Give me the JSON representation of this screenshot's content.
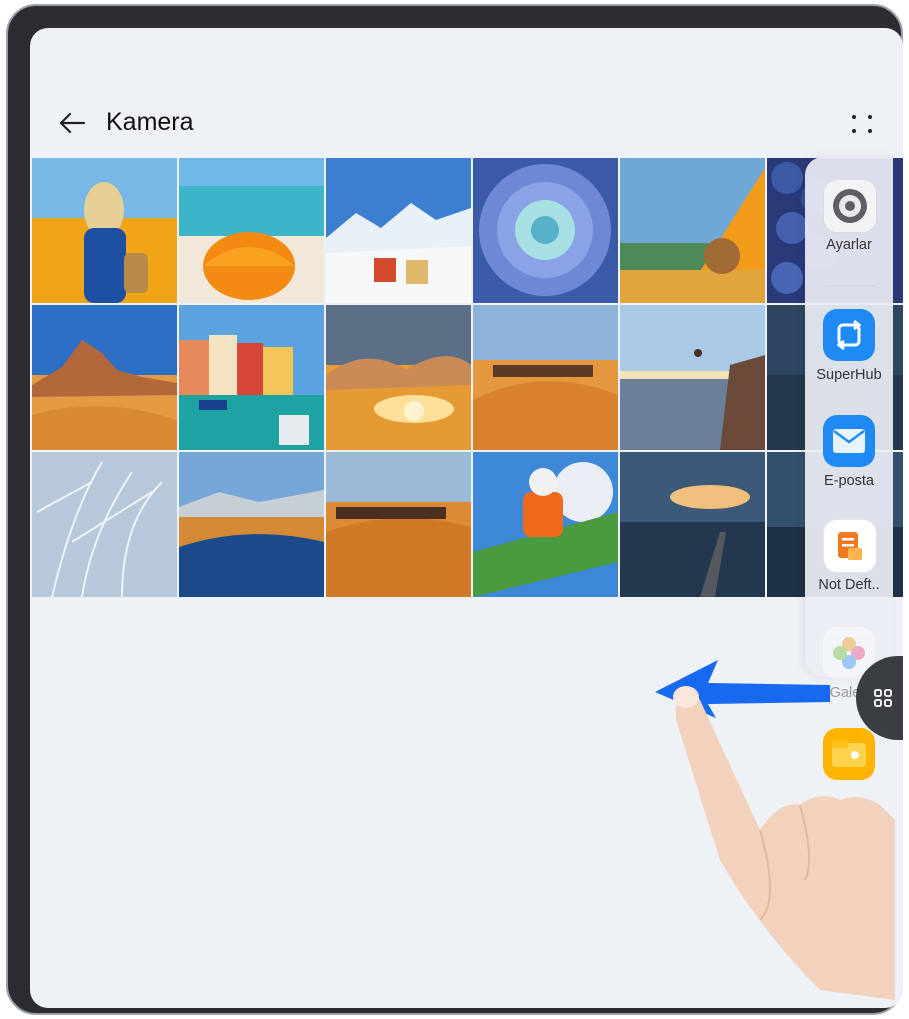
{
  "header": {
    "title": "Kamera",
    "back_icon": "arrow-left-icon",
    "more_icon": "four-dots-icon"
  },
  "gallery": {
    "thumbnails": [
      "woman in sunflower field",
      "orange umbrella on beach",
      "snowy mountains with beach chairs",
      "blue succulent",
      "tent with teddy bear",
      "blueberries",
      "desert rock formation",
      "colorful harbour houses",
      "sunset over clouds",
      "camel caravan in desert",
      "person cliff diving at sea",
      "dark coastline",
      "dandelion seeds",
      "river through desert",
      "camel caravan at dusk",
      "snowboarder jump",
      "pier at sea sunset",
      "coastal dusk"
    ]
  },
  "side_dock": {
    "apps": [
      {
        "label": "Ayarlar",
        "icon": "settings-gear-icon",
        "color": "#6b6f75"
      },
      {
        "label": "SuperHub",
        "icon": "superhub-icon",
        "color": "#1e8bf5"
      },
      {
        "label": "E-posta",
        "icon": "envelope-icon",
        "color": "#1e8bf5"
      },
      {
        "label": "Not Deft..",
        "icon": "notepad-icon",
        "color": "#f07a1e"
      },
      {
        "label": "Galeri",
        "icon": "gallery-flower-icon",
        "color": "#e85d8a"
      },
      {
        "label": "",
        "icon": "files-folder-icon",
        "color": "#ffb400"
      }
    ],
    "handle_icon": "app-grid-icon"
  },
  "gesture": {
    "arrow_color": "#1769f0",
    "description_icon": "swipe-left-hand-icon"
  }
}
